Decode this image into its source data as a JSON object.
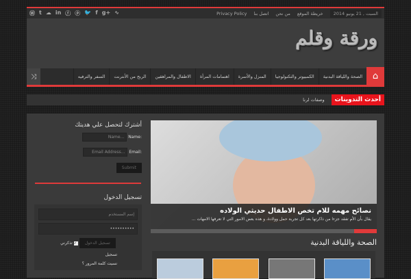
{
  "topbar": {
    "social_icons": [
      "wordpress-icon",
      "tumblr-icon",
      "stumbleupon-icon",
      "linkedin-icon",
      "foursquare-icon",
      "pinterest-icon",
      "twitter-icon",
      "facebook-icon",
      "google-plus-icon",
      "rss-icon"
    ],
    "social_glyphs": [
      "Ⓦ",
      "t",
      "☁",
      "in",
      "ⓕ",
      "ⓟ",
      "🐦",
      "f",
      "g+",
      "∿"
    ],
    "links": [
      "Privacy Policy",
      "اتصل بنا",
      "من نحن",
      "خريطة الموقع"
    ],
    "date": "السبت , 21 يونيو 2014"
  },
  "logo": "ورقة وقلم",
  "nav": {
    "items": [
      "الصحة واللياقة البدنية",
      "الكمبيوتر والتكنولوجيا",
      "المنزل والأسرة",
      "اهتمامات المرأة",
      "الاطفال والمراهقين",
      "الربح من الأنترنت",
      "السفر والترفيه"
    ]
  },
  "ticker": {
    "label": "أحدث التدوينات",
    "item": "وصفات لرنا"
  },
  "slider": {
    "title": "نصائح مهمه للام تخص الاطفال حديثي الولاده",
    "excerpt": "يقال بأن الأم تفقد جزءا من ذاكرتها بعد كل تجربة حمل وولادة، و هذه بعض الامور التي لا تعرفها الامهات ...",
    "progress": 0.1
  },
  "section": {
    "title": "الصحة واللياقة البدنية"
  },
  "subscribe": {
    "title": "أشترك لتحصل علي هديتك",
    "name_label": "Name:",
    "name_placeholder": "Name...",
    "email_label": "Email:",
    "email_placeholder": "Email Address...",
    "submit": "Submit"
  },
  "login": {
    "title": "تسجيل الدخول",
    "user_placeholder": "إسم المستخدم",
    "password_value": "••••••••••",
    "button": "تسجيل الدخول",
    "remember": "تذكرني",
    "register": "تسجيل",
    "forgot": "نسيت كلمة المرور ؟"
  }
}
